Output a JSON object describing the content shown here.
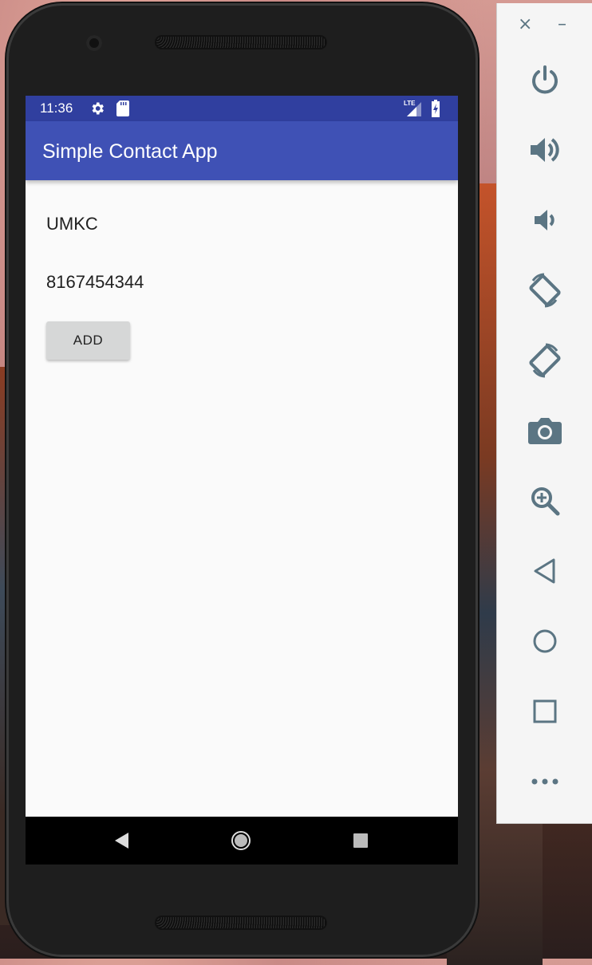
{
  "status_bar": {
    "time": "11:36",
    "network": "LTE"
  },
  "app_bar": {
    "title": "Simple Contact App"
  },
  "form": {
    "name_value": "UMKC",
    "phone_value": "8167454344",
    "add_label": "ADD"
  },
  "nav_bar": {
    "buttons": [
      "back-icon",
      "home-icon",
      "recents-icon"
    ]
  },
  "emulator_panel": {
    "close_label": "×",
    "minimize_label": "–",
    "buttons": [
      "power-icon",
      "volume-up-icon",
      "volume-down-icon",
      "rotate-left-icon",
      "rotate-right-icon",
      "camera-icon",
      "zoom-icon",
      "back-icon",
      "home-icon",
      "overview-icon",
      "more-icon"
    ],
    "icon_color": "#5b7583"
  },
  "colors": {
    "status_bar": "#303f9f",
    "app_bar": "#3f51b5",
    "background": "#fafafa"
  }
}
